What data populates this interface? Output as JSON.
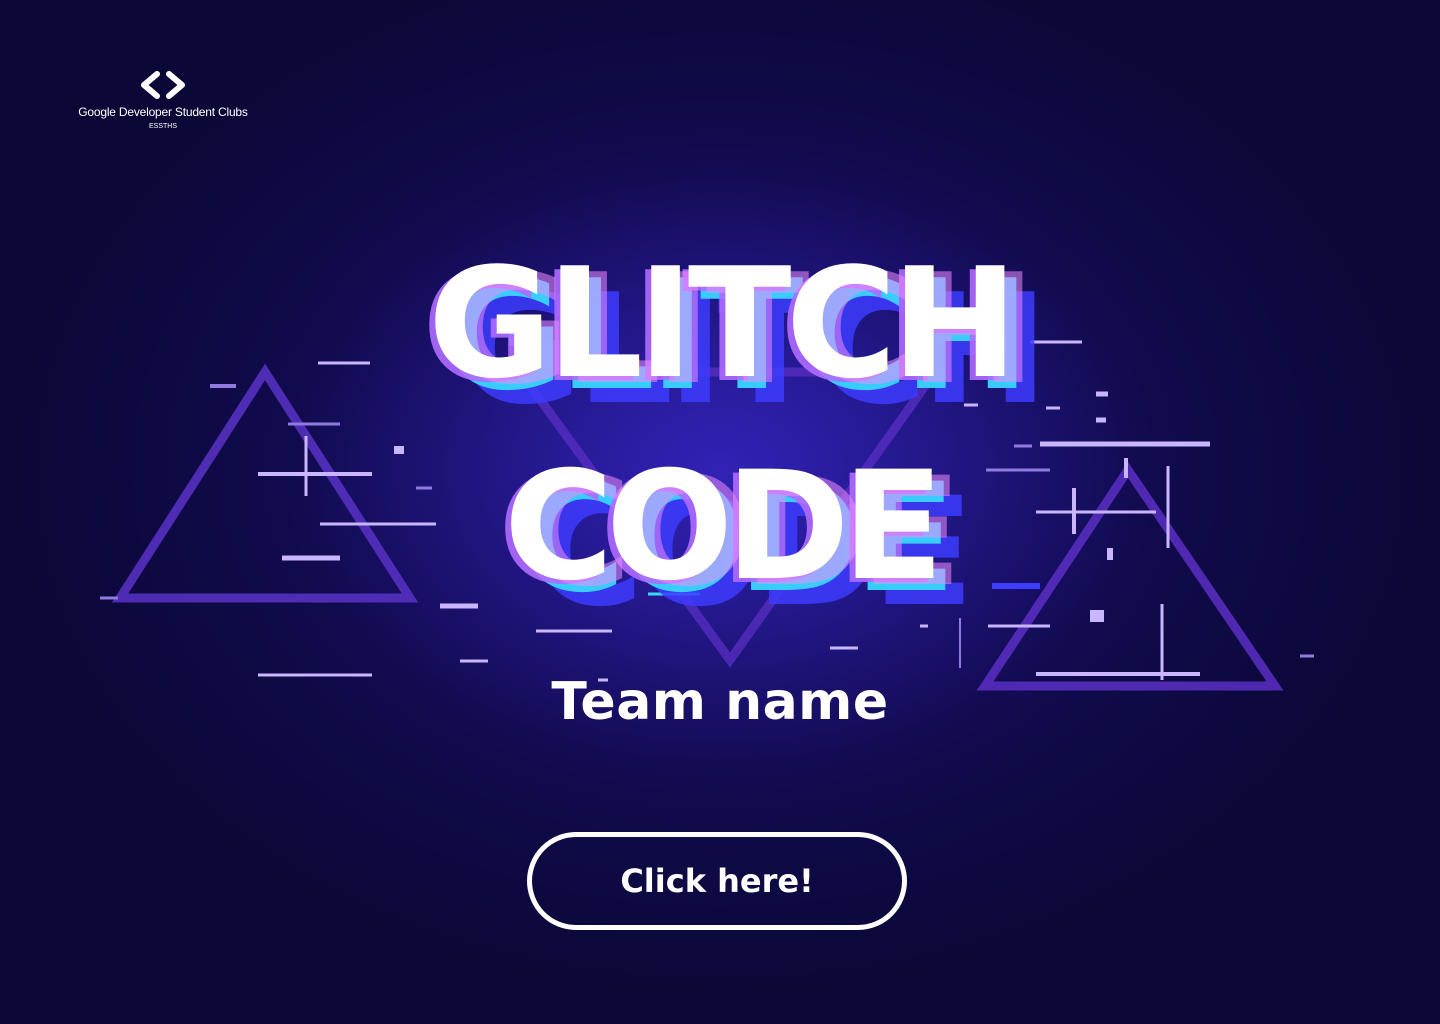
{
  "logo": {
    "icon": "code-brackets-icon",
    "title": "Google Developer Student Clubs",
    "subtitle": "ESSTHS"
  },
  "hero": {
    "title_line_1": "GLITCH",
    "title_line_2": "CODE",
    "glitch_colors": [
      "#38d6ff",
      "#b06bff",
      "#3d3cff",
      "#f08cff"
    ],
    "team_name": "Team name"
  },
  "cta": {
    "label": "Click here!"
  },
  "colors": {
    "background": "#0f0a48",
    "triangle": "#5a2fc4",
    "accent": "#ffffff"
  }
}
